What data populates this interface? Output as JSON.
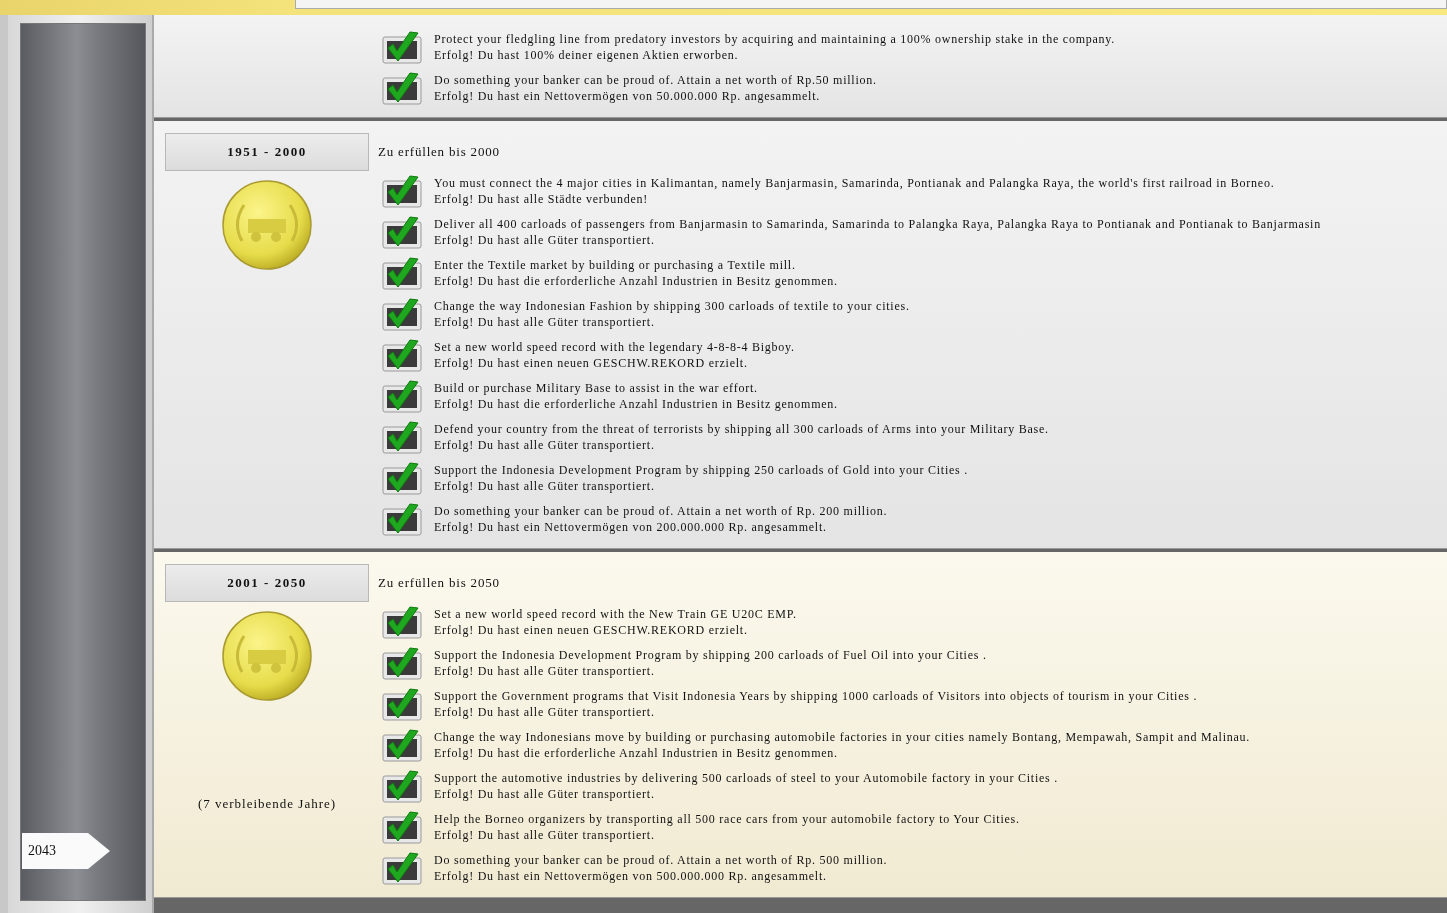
{
  "sidebar": {
    "current_year": "2043"
  },
  "sections": [
    {
      "current": false,
      "objectives": [
        {
          "text": "Protect your fledgling line from predatory investors by acquiring and maintaining a 100% ownership stake in the company.",
          "result": "Erfolg! Du hast 100% deiner eigenen Aktien erworben.",
          "completed": true
        },
        {
          "text": "Do something your banker can be proud of. Attain a net worth of Rp.50 million.",
          "result": "Erfolg! Du hast ein Nettovermögen von 50.000.000 Rp. angesammelt.",
          "completed": true
        }
      ]
    },
    {
      "years": "1951 - 2000",
      "deadline": "Zu erfüllen bis 2000",
      "current": false,
      "objectives": [
        {
          "text": "You must connect the 4 major cities in Kalimantan, namely Banjarmasin, Samarinda, Pontianak and Palangka Raya, the world's first railroad in Borneo.",
          "result": "Erfolg! Du hast alle Städte verbunden!",
          "completed": true
        },
        {
          "text": "Deliver all 400 carloads of passengers from Banjarmasin to Samarinda, Samarinda to Palangka Raya, Palangka Raya to Pontianak and Pontianak to Banjarmasin",
          "result": "Erfolg! Du hast alle Güter transportiert.",
          "completed": true
        },
        {
          "text": "Enter the Textile market by building or purchasing a Textile mill.",
          "result": "Erfolg! Du hast die erforderliche Anzahl Industrien in Besitz genommen.",
          "completed": true
        },
        {
          "text": "Change the way Indonesian Fashion by shipping 300 carloads of textile to your cities.",
          "result": "Erfolg! Du hast alle Güter transportiert.",
          "completed": true
        },
        {
          "text": "Set a new world speed record with the legendary 4-8-8-4 Bigboy.",
          "result": "Erfolg! Du hast einen neuen GESCHW.REKORD erzielt.",
          "completed": true
        },
        {
          "text": "Build or purchase Military Base to assist in the war effort.",
          "result": "Erfolg! Du hast die erforderliche Anzahl Industrien in Besitz genommen.",
          "completed": true
        },
        {
          "text": "Defend your country from the threat of terrorists by shipping all 300 carloads of Arms into your Military Base.",
          "result": "Erfolg! Du hast alle Güter transportiert.",
          "completed": true
        },
        {
          "text": "Support the Indonesia Development Program by shipping 250 carloads of Gold into your Cities .",
          "result": "Erfolg! Du hast alle Güter transportiert.",
          "completed": true
        },
        {
          "text": "Do something your banker can be proud of. Attain a net worth of Rp. 200 million.",
          "result": "Erfolg! Du hast ein Nettovermögen von 200.000.000 Rp. angesammelt.",
          "completed": true
        }
      ]
    },
    {
      "years": "2001 - 2050",
      "deadline": "Zu erfüllen bis 2050",
      "current": true,
      "remaining": "(7 verbleibende Jahre)",
      "objectives": [
        {
          "text": "Set a new world speed record with the New Train GE U20C EMP.",
          "result": "Erfolg! Du hast einen neuen GESCHW.REKORD erzielt.",
          "completed": true
        },
        {
          "text": "Support the Indonesia Development Program by shipping 200 carloads of Fuel Oil into your Cities .",
          "result": "Erfolg! Du hast alle Güter transportiert.",
          "completed": true
        },
        {
          "text": "Support the Government programs that  Visit Indonesia Years by shipping 1000 carloads of Visitors into objects of tourism in your Cities .",
          "result": "Erfolg! Du hast alle Güter transportiert.",
          "completed": true
        },
        {
          "text": "Change the way Indonesians move by building or purchasing automobile factories in your cities namely Bontang, Mempawah, Sampit and Malinau.",
          "result": "Erfolg! Du hast die erforderliche Anzahl Industrien in Besitz genommen.",
          "completed": true
        },
        {
          "text": "Support the automotive industries by delivering 500 carloads of steel to your Automobile factory in your Cities .",
          "result": "Erfolg! Du hast alle Güter transportiert.",
          "completed": true
        },
        {
          "text": "Help the Borneo organizers by transporting all 500 race cars from your automobile factory to Your Cities.",
          "result": "Erfolg! Du hast alle Güter transportiert.",
          "completed": true
        },
        {
          "text": "Do something your banker can be proud of. Attain a net worth of Rp. 500 million.",
          "result": "Erfolg! Du hast ein Nettovermögen von 500.000.000 Rp. angesammelt.",
          "completed": true
        }
      ]
    }
  ]
}
